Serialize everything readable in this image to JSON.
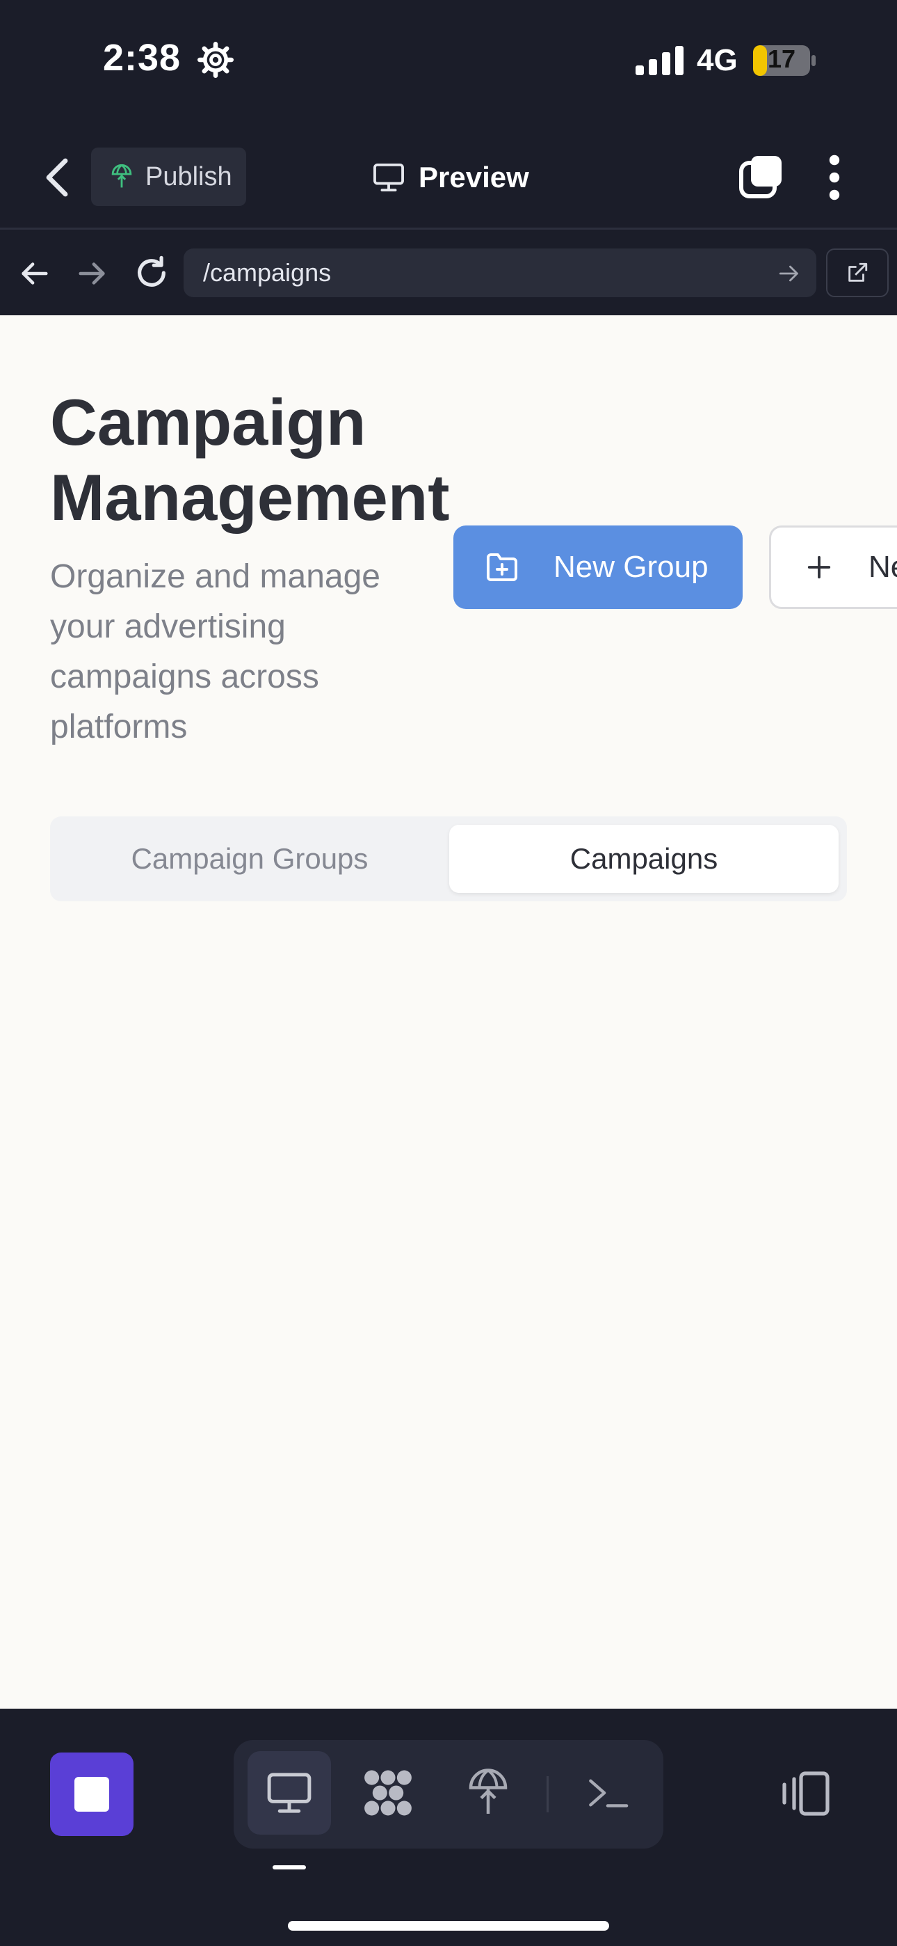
{
  "status_bar": {
    "time": "2:38",
    "network": "4G",
    "battery": "17"
  },
  "toolbar": {
    "publish_label": "Publish",
    "preview_label": "Preview"
  },
  "url_bar": {
    "url": "/campaigns"
  },
  "page": {
    "title": "Campaign Management",
    "subtitle": "Organize and manage your advertising campaigns across platforms",
    "new_group_label": "New Group",
    "new_campaign_label": "Ne",
    "tabs": [
      {
        "label": "Campaign Groups",
        "active": false
      },
      {
        "label": "Campaigns",
        "active": true
      }
    ]
  },
  "colors": {
    "accent": "#5b8fe1",
    "stop_button": "#5a3fd6",
    "chrome_bg": "#1b1d29",
    "content_bg": "#fbfaf7",
    "publish_icon": "#3fbf7f"
  },
  "icons": {
    "status": [
      "gear-icon",
      "signal-icon",
      "battery-icon"
    ],
    "toolbar": [
      "chevron-left-icon",
      "globe-icon",
      "monitor-icon",
      "tabs-icon",
      "kebab-icon"
    ],
    "url_bar": [
      "arrow-left-icon",
      "arrow-right-icon",
      "reload-icon",
      "arrow-right-small-icon",
      "external-link-icon"
    ],
    "dock": [
      "stop-icon",
      "monitor-icon",
      "grid-blob-icon",
      "publish-globe-icon",
      "terminal-icon",
      "layout-icon"
    ]
  }
}
